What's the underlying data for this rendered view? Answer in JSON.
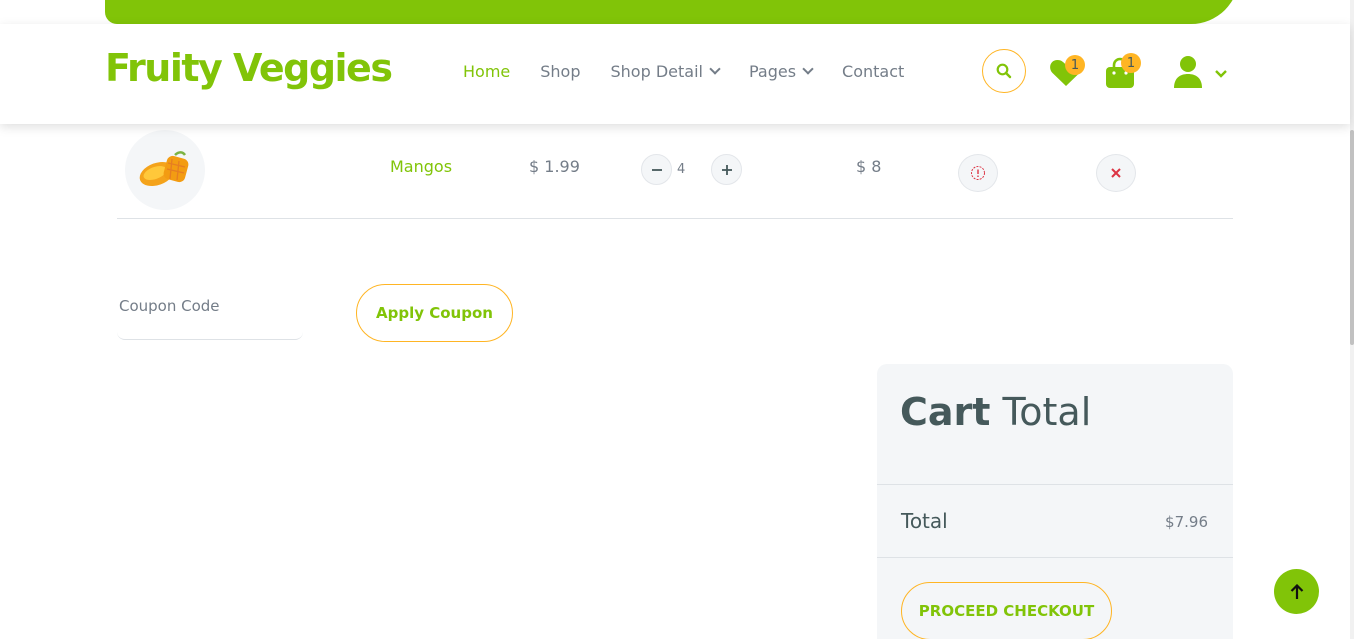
{
  "brand": {
    "name": "Fruity Veggies"
  },
  "nav": {
    "items": [
      {
        "label": "Home"
      },
      {
        "label": "Shop"
      },
      {
        "label": "Shop Detail"
      },
      {
        "label": "Pages"
      },
      {
        "label": "Contact"
      }
    ],
    "wishlist_count": "1",
    "cart_count": "1"
  },
  "cart": {
    "row": {
      "name": "Mangos",
      "price": "$ 1.99",
      "quantity": "4",
      "total": "$ 8"
    }
  },
  "coupon": {
    "placeholder": "Coupon Code",
    "apply_label": "Apply Coupon"
  },
  "cart_total": {
    "title_bold": "Cart",
    "title_rest": "Total",
    "total_label": "Total",
    "total_value": "$7.96",
    "checkout_label": "PROCEED CHECKOUT"
  },
  "colors": {
    "primary": "#81c408",
    "secondary": "#ffb524",
    "text": "#45595b",
    "danger": "#dc3545"
  }
}
